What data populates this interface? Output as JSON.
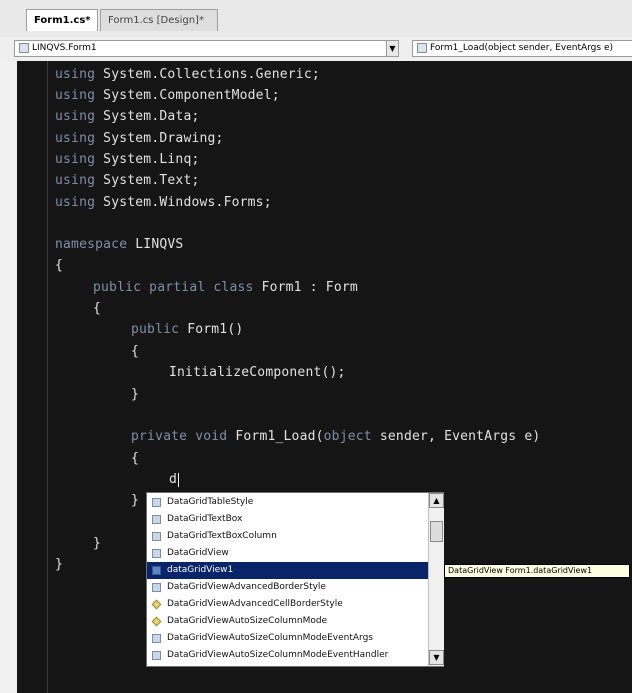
{
  "tabs": [
    {
      "label": "Form1.cs*",
      "active": true
    },
    {
      "label": "Form1.cs [Design]*",
      "active": false
    }
  ],
  "navbar": {
    "class_selector": "LINQVS.Form1",
    "member_selector": "Form1_Load(object sender, EventArgs e)"
  },
  "code": {
    "usings": [
      {
        "kw": "using",
        "ns": "System.Collections.Generic;"
      },
      {
        "kw": "using",
        "ns": "System.ComponentModel;"
      },
      {
        "kw": "using",
        "ns": "System.Data;"
      },
      {
        "kw": "using",
        "ns": "System.Drawing;"
      },
      {
        "kw": "using",
        "ns": "System.Linq;"
      },
      {
        "kw": "using",
        "ns": "System.Text;"
      },
      {
        "kw": "using",
        "ns": "System.Windows.Forms;"
      }
    ],
    "namespace_kw": "namespace",
    "namespace_name": "LINQVS",
    "class_kw": "public partial class",
    "class_name": "Form1",
    "class_base": ": Form",
    "ctor_kw": "public",
    "ctor_name": "Form1()",
    "init_call": "InitializeComponent();",
    "method_kw1": "private",
    "method_kw2": "void",
    "method_name": "Form1_Load(",
    "param_kw": "object",
    "params_rest": "sender, EventArgs e)",
    "typed": "d",
    "open_brace": "{",
    "close_brace": "}"
  },
  "intellisense": {
    "items": [
      {
        "label": "DataGridTableStyle",
        "kind": "class"
      },
      {
        "label": "DataGridTextBox",
        "kind": "class"
      },
      {
        "label": "DataGridTextBoxColumn",
        "kind": "class"
      },
      {
        "label": "DataGridView",
        "kind": "class"
      },
      {
        "label": "dataGridView1",
        "kind": "field",
        "selected": true
      },
      {
        "label": "DataGridViewAdvancedBorderStyle",
        "kind": "class"
      },
      {
        "label": "DataGridViewAdvancedCellBorderStyle",
        "kind": "prop"
      },
      {
        "label": "DataGridViewAutoSizeColumnMode",
        "kind": "prop"
      },
      {
        "label": "DataGridViewAutoSizeColumnModeEventArgs",
        "kind": "class"
      },
      {
        "label": "DataGridViewAutoSizeColumnModeEventHandler",
        "kind": "class"
      }
    ],
    "tooltip": "DataGridView Form1.dataGridView1"
  },
  "colors": {
    "editor_bg": "#151515",
    "keyword": "#7f8ea8",
    "selection": "#0a246a"
  }
}
